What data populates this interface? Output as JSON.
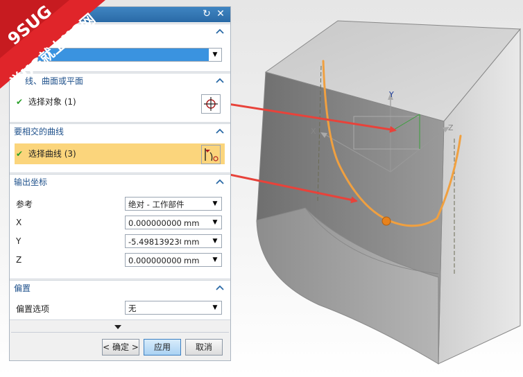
{
  "watermark": {
    "line1": "9SUG",
    "line2": "学UG就上UG网"
  },
  "dialog": {
    "selected_item_label": "",
    "section_plane": {
      "header": "线、曲面或平面",
      "select_label": "选择对象 (1)"
    },
    "section_curves": {
      "header": "要相交的曲线",
      "select_label": "选择曲线 (3)"
    },
    "section_output": {
      "header": "输出坐标",
      "reference_label": "参考",
      "reference_value": "绝对 - 工作部件",
      "x_label": "X",
      "x_value": "0.000000000",
      "x_unit": "mm",
      "y_label": "Y",
      "y_value": "-5.498139230",
      "y_unit": "mm",
      "z_label": "Z",
      "z_value": "0.000000000",
      "z_unit": "mm"
    },
    "section_offset": {
      "header": "偏置",
      "option_label": "偏置选项",
      "option_value": "无"
    },
    "buttons": {
      "ok": "< 确定 >",
      "apply": "应用",
      "cancel": "取消"
    }
  },
  "viewport": {
    "axis_x": "X",
    "axis_y": "Y",
    "axis_z": "Z"
  },
  "colors": {
    "title_bar": "#2f78b8",
    "highlight_row": "#fbd57c",
    "selection_bar": "#3a93e0",
    "curve": "#f0a040",
    "annotation_arrow": "#e8423a"
  }
}
